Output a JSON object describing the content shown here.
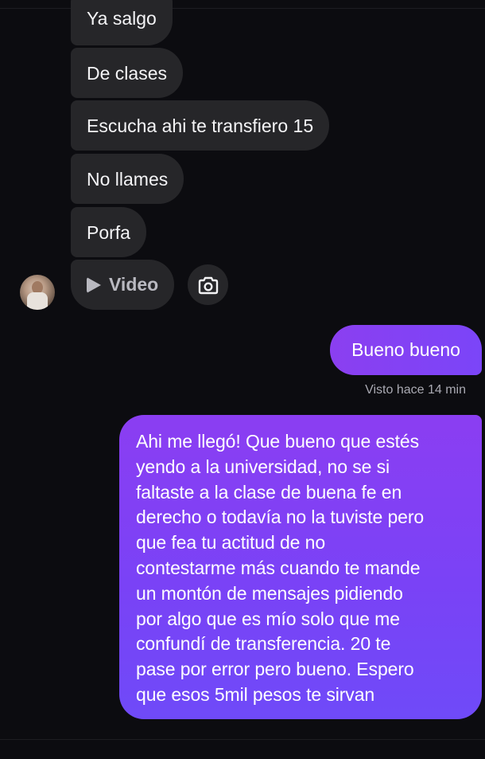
{
  "chat": {
    "incoming": [
      {
        "text": "Ya salgo"
      },
      {
        "text": "De clases"
      },
      {
        "text": "Escucha ahi te transfiero 15"
      },
      {
        "text": "No llames"
      },
      {
        "text": "Porfa"
      }
    ],
    "video_attachment": {
      "label": "Video",
      "icon": "play-icon"
    },
    "camera_button": {
      "icon": "camera-icon"
    },
    "avatar": {
      "icon": "contact-avatar"
    },
    "outgoing_short": {
      "text": "Bueno bueno"
    },
    "seen_status": "Visto hace 14 min",
    "outgoing_long": {
      "lines": [
        "Ahi me llegó! Que bueno que estés",
        "yendo a la universidad, no se si",
        "faltaste a la clase de buena fe en",
        "derecho o todavía no la tuviste pero",
        "que fea tu actitud de no",
        "contestarme más cuando te mande",
        "un montón de mensajes pidiendo",
        "por algo que es mío solo que me",
        "confundí de transferencia. 20 te",
        "pase por error pero bueno. Espero",
        "que esos 5mil pesos te sirvan"
      ]
    }
  },
  "colors": {
    "background": "#0c0c10",
    "incoming_bubble": "#262629",
    "outgoing_bubble": "#8b3ff0"
  }
}
